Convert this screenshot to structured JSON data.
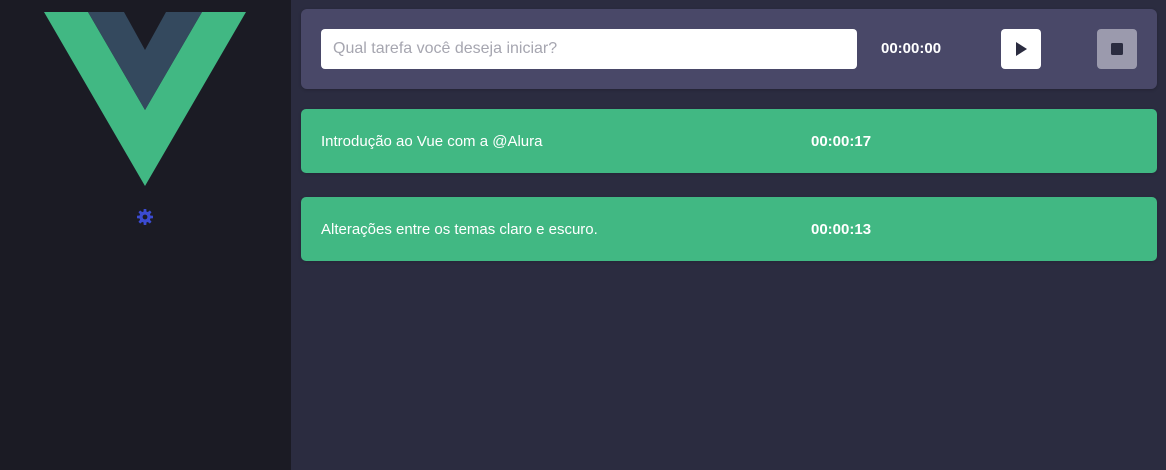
{
  "sidebar": {
    "logo_icon": "vue-logo",
    "theme_toggle_icon": "gear-icon",
    "theme_toggle_color": "#3b4bd1"
  },
  "form": {
    "input_placeholder": "Qual tarefa você deseja iniciar?",
    "input_value": "",
    "timer": "00:00:00",
    "play_icon": "play-icon",
    "stop_icon": "stop-icon"
  },
  "tasks": [
    {
      "name": "Introdução ao Vue com a @Alura",
      "duration": "00:00:17"
    },
    {
      "name": "Alterações entre os temas claro e escuro.",
      "duration": "00:00:13"
    }
  ],
  "colors": {
    "sidebar_bg": "#1b1b24",
    "main_bg": "#2b2c40",
    "form_bg": "#494868",
    "task_bg": "#41b883",
    "vue_green": "#41b883",
    "vue_dark": "#34495e"
  }
}
